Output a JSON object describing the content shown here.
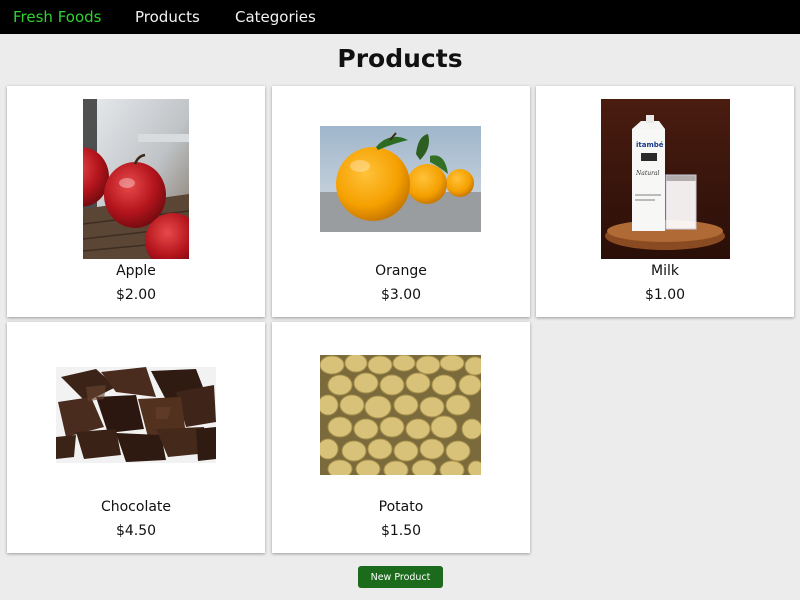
{
  "nav": {
    "brand": "Fresh Foods",
    "products": "Products",
    "categories": "Categories",
    "brand_color": "#2fd22f",
    "background": "#000000"
  },
  "page": {
    "title": "Products"
  },
  "products": [
    {
      "name": "Apple",
      "price": "$2.00",
      "image": "apple-photo"
    },
    {
      "name": "Orange",
      "price": "$3.00",
      "image": "orange-photo"
    },
    {
      "name": "Milk",
      "price": "$1.00",
      "image": "milk-photo"
    },
    {
      "name": "Chocolate",
      "price": "$4.50",
      "image": "chocolate-photo"
    },
    {
      "name": "Potato",
      "price": "$1.50",
      "image": "potato-photo"
    }
  ],
  "actions": {
    "new_product": "New Product",
    "button_color": "#1c6b1c"
  }
}
